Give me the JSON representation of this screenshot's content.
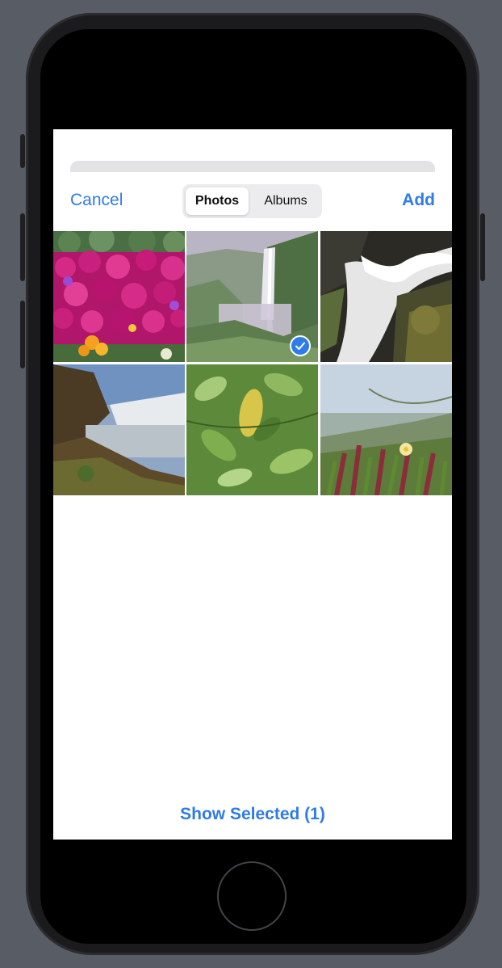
{
  "header": {
    "cancel_label": "Cancel",
    "add_label": "Add",
    "tabs": [
      {
        "label": "Photos",
        "selected": true
      },
      {
        "label": "Albums",
        "selected": false
      }
    ]
  },
  "photos": [
    {
      "name": "pink-flowers",
      "selected": false
    },
    {
      "name": "waterfall-valley",
      "selected": true
    },
    {
      "name": "waterfall-rocks",
      "selected": false
    },
    {
      "name": "waterfall-cliff",
      "selected": false
    },
    {
      "name": "green-leaves",
      "selected": false
    },
    {
      "name": "beach-plants",
      "selected": false
    }
  ],
  "footer": {
    "show_selected_label": "Show Selected (1)"
  },
  "colors": {
    "accent": "#2f7be8",
    "background": "#585c64"
  },
  "icons": {
    "selected_check": "checkmark-circle-icon"
  }
}
